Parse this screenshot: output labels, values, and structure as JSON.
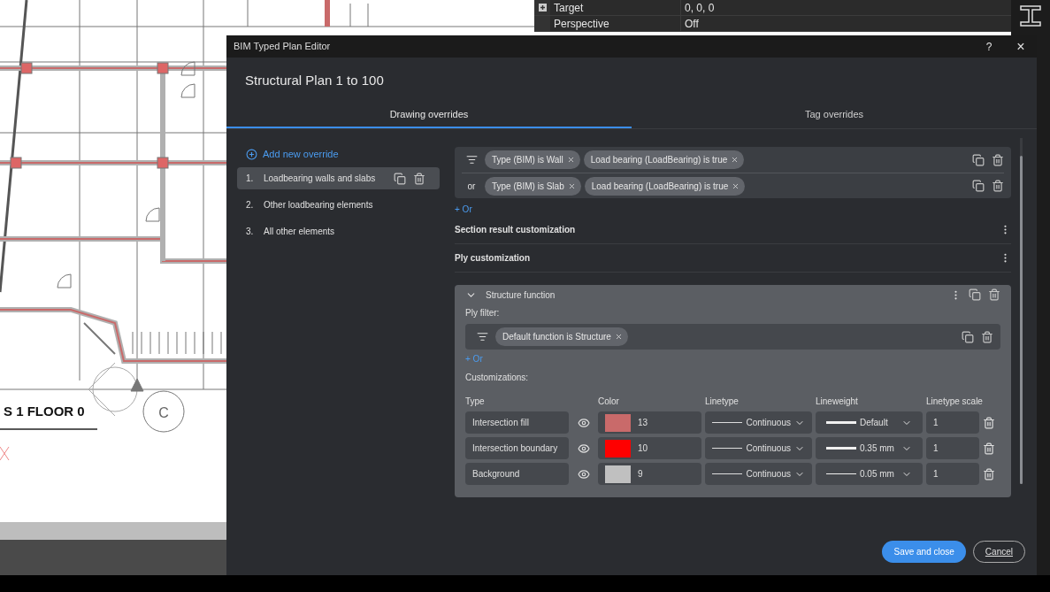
{
  "drawing": {
    "floor_label": "S 1 FLOOR 0",
    "grid_bubble": "C"
  },
  "properties": [
    {
      "label": "Target",
      "value": "0, 0, 0",
      "expandable": true
    },
    {
      "label": "Perspective",
      "value": "Off",
      "expandable": false
    }
  ],
  "dialog": {
    "title": "BIM Typed Plan Editor",
    "help": "?",
    "close": "×",
    "heading": "Structural Plan 1 to 100",
    "tabs": [
      {
        "label": "Drawing overrides",
        "selected": true
      },
      {
        "label": "Tag overrides",
        "selected": false
      }
    ],
    "add_override": "Add new override",
    "overrides": [
      {
        "number": "1.",
        "label": "Loadbearing walls and slabs",
        "selected": true
      },
      {
        "number": "2.",
        "label": "Other loadbearing elements",
        "selected": false
      },
      {
        "number": "3.",
        "label": "All other elements",
        "selected": false
      }
    ],
    "filter_rows": [
      {
        "kind": "filter",
        "chips": [
          "Type (BIM) is Wall",
          "Load bearing (LoadBearing) is true"
        ]
      },
      {
        "kind": "or",
        "connector": "or",
        "chips": [
          "Type (BIM) is Slab",
          "Load bearing (LoadBearing) is true"
        ]
      }
    ],
    "add_or": "+ Or",
    "sections": [
      {
        "title": "Section result customization"
      },
      {
        "title": "Ply customization"
      }
    ],
    "ply": {
      "title": "Structure function",
      "expanded": true,
      "filter_label": "Ply filter:",
      "filter_chips": [
        "Default function is Structure"
      ],
      "add_or": "+ Or",
      "customizations_label": "Customizations:",
      "columns": [
        "Type",
        "Color",
        "Linetype",
        "Lineweight",
        "Linetype scale"
      ],
      "rows": [
        {
          "type": "Intersection fill",
          "visible": true,
          "color": "#c96a6a",
          "color_number": "13",
          "linetype": "Continuous",
          "heavy_line": true,
          "lineweight": "Default",
          "scale": "1"
        },
        {
          "type": "Intersection boundary",
          "visible": true,
          "color": "#ff0000",
          "color_number": "10",
          "linetype": "Continuous",
          "heavy_line": true,
          "lineweight": "0.35 mm",
          "scale": "1"
        },
        {
          "type": "Background",
          "visible": true,
          "color": "#c0c0c0",
          "color_number": "9",
          "linetype": "Continuous",
          "heavy_line": false,
          "lineweight": "0.05 mm",
          "scale": "1"
        }
      ]
    },
    "buttons": {
      "save": "Save and close",
      "cancel": "Cancel"
    }
  }
}
